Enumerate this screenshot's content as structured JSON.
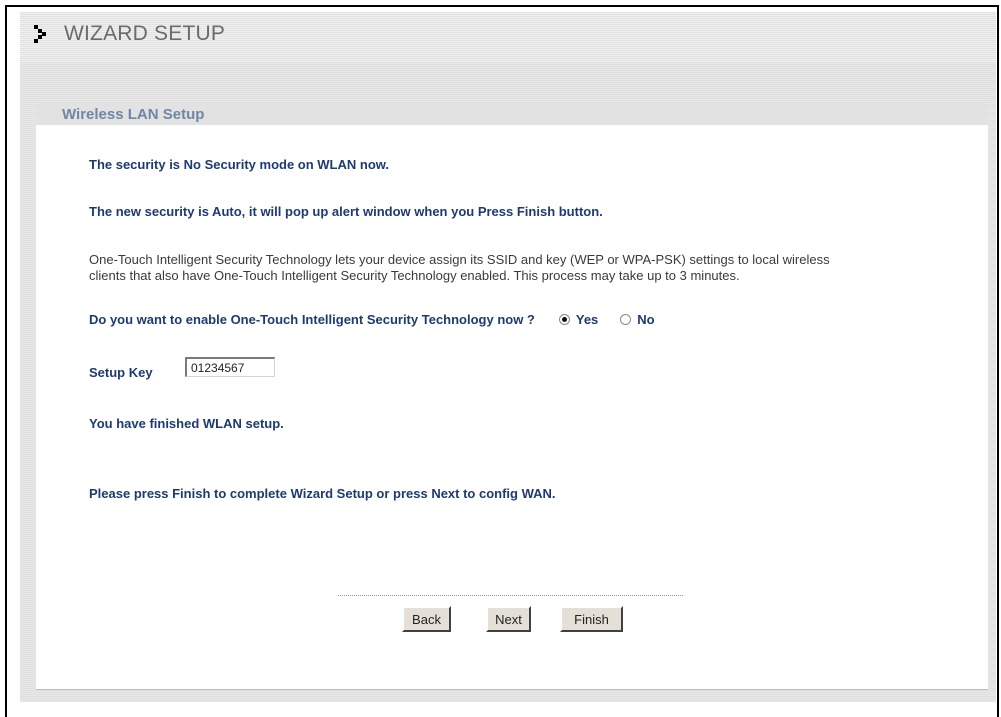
{
  "header": {
    "title": "WIZARD SETUP",
    "arrow_icon": "arrow-bullet-icon"
  },
  "section": {
    "title": "Wireless LAN Setup"
  },
  "messages": {
    "security_mode": "The security is No Security mode on WLAN now.",
    "new_security": "The new security is Auto, it will pop up alert window when you Press Finish button.",
    "description": "One-Touch Intelligent Security Technology lets your device assign its SSID and key (WEP or WPA-PSK) settings to local wireless clients that also have One-Touch Intelligent Security Technology enabled. This process may take up to 3 minutes.",
    "question": "Do you want to enable One-Touch Intelligent Security Technology now ?",
    "finished": "You have finished WLAN setup.",
    "instruction": "Please press Finish to complete Wizard Setup or press Next to config WAN."
  },
  "ots_options": {
    "yes_label": "Yes",
    "no_label": "No",
    "selected": "Yes"
  },
  "setup_key": {
    "label": "Setup Key",
    "value": "01234567"
  },
  "buttons": {
    "back": "Back",
    "next": "Next",
    "finish": "Finish"
  },
  "colors": {
    "heading_text": "#1d3a72",
    "section_header_text": "#6f86a6",
    "title_text": "#6b6b6b"
  }
}
